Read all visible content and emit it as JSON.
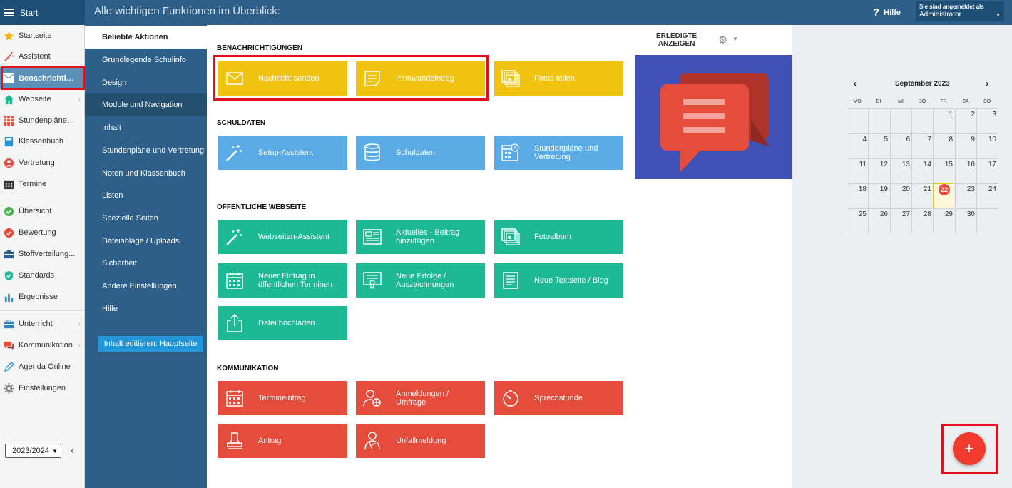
{
  "topbar": {
    "start_label": "Start",
    "help_label": "Hilfe",
    "login_line1": "Sie sind angemeldet als",
    "login_line2": "Administrator"
  },
  "sidebar": {
    "items": [
      {
        "label": "Startseite",
        "icon": "star-icon"
      },
      {
        "label": "Assistent",
        "icon": "wand-icon"
      },
      {
        "label": "Benachrichtig...",
        "icon": "envelope-icon"
      },
      {
        "label": "Webseite",
        "icon": "home-icon"
      },
      {
        "label": "Stundenpläne ...",
        "icon": "timetable-icon"
      },
      {
        "label": "Klassenbuch",
        "icon": "book-icon"
      },
      {
        "label": "Vertretung",
        "icon": "substitute-icon"
      },
      {
        "label": "Termine",
        "icon": "calendar-icon"
      },
      {
        "label": "Übersicht",
        "icon": "check-circle-icon"
      },
      {
        "label": "Bewertung",
        "icon": "rating-icon"
      },
      {
        "label": "Stoffverteilung...",
        "icon": "distribution-icon"
      },
      {
        "label": "Standards",
        "icon": "shield-check-icon"
      },
      {
        "label": "Ergebnisse",
        "icon": "bar-chart-icon"
      },
      {
        "label": "Unterricht",
        "icon": "briefcase-icon"
      },
      {
        "label": "Kommunikation",
        "icon": "chat-icon"
      },
      {
        "label": "Agenda Online",
        "icon": "pen-icon"
      },
      {
        "label": "Einstellungen",
        "icon": "gear-icon"
      }
    ],
    "year": "2023/2024"
  },
  "overlay": {
    "title": "Alle wichtigen Funktionen im Überblick:",
    "menu": [
      "Beliebte Aktionen",
      "Grundlegende Schulinfo",
      "Design",
      "Module und Navigation",
      "Inhalt",
      "Stundenpläne und Vertretung",
      "Noten und Klassenbuch",
      "Listen",
      "Spezielle Seiten",
      "Dateiablage / Uploads",
      "Sicherheit",
      "Andere Einstellungen",
      "Hilfe"
    ],
    "edit_button": "Inhalt editieren: Hauptseite",
    "sections": {
      "benachrichtigungen": "BENACHRICHTIGUNGEN",
      "schuldaten": "SCHULDATEN",
      "webseite": "ÖFFENTLICHE WEBSEITE",
      "kommunikation": "KOMMUNIKATION"
    },
    "tiles": {
      "nachricht": "Nachricht senden",
      "pinnwand": "Pinnwandeintrag",
      "fotos_teilen": "Fotos teilen",
      "setup": "Setup-Assistent",
      "schuldaten": "Schuldaten",
      "stundenplaene_1": "Stundenpläne und",
      "stundenplaene_2": "Vertretung",
      "webseiten_assistent": "Webseiten-Assistent",
      "aktuelles_1": "Aktuelles - Beitrag",
      "aktuelles_2": "hinzufügen",
      "fotoalbum": "Fotoalbum",
      "eintrag_1": "Neuer Eintrag in",
      "eintrag_2": "öffentlichen Terminen",
      "erfolge_1": "Neue Erfolge /",
      "erfolge_2": "Auszeichnungen",
      "textseite": "Neue Textseite / Blog",
      "datei": "Datei hochladen",
      "termineintrag": "Termineintrag",
      "anmeldungen_1": "Anmeldungen /",
      "anmeldungen_2": "Umfrage",
      "sprechstunde": "Sprechstunde",
      "antrag": "Antrag",
      "unfall": "Unfallmeldung"
    }
  },
  "right": {
    "erledigte_1": "ERLEDIGTE",
    "erledigte_2": "ANZEIGEN"
  },
  "calendar": {
    "month": "September 2023",
    "prev": "‹",
    "next": "›",
    "weekdays": [
      "MO",
      "DI",
      "MI",
      "DO",
      "FR",
      "SA",
      "SO"
    ],
    "weeks": [
      [
        "",
        "",
        "",
        "",
        "1",
        "2",
        "3"
      ],
      [
        "4",
        "5",
        "6",
        "7",
        "8",
        "9",
        "10"
      ],
      [
        "11",
        "12",
        "13",
        "14",
        "15",
        "16",
        "17"
      ],
      [
        "18",
        "19",
        "20",
        "21",
        "22",
        "23",
        "24"
      ],
      [
        "25",
        "26",
        "27",
        "28",
        "29",
        "30",
        ""
      ]
    ],
    "today": "22"
  },
  "fab_label": "+",
  "colors": {
    "header": "#2d5f8a",
    "tile_yellow": "#f0c30f",
    "tile_blue": "#5aaae5",
    "tile_green": "#1db894",
    "tile_red": "#e64c3c",
    "highlight_box": "#e2111d"
  }
}
